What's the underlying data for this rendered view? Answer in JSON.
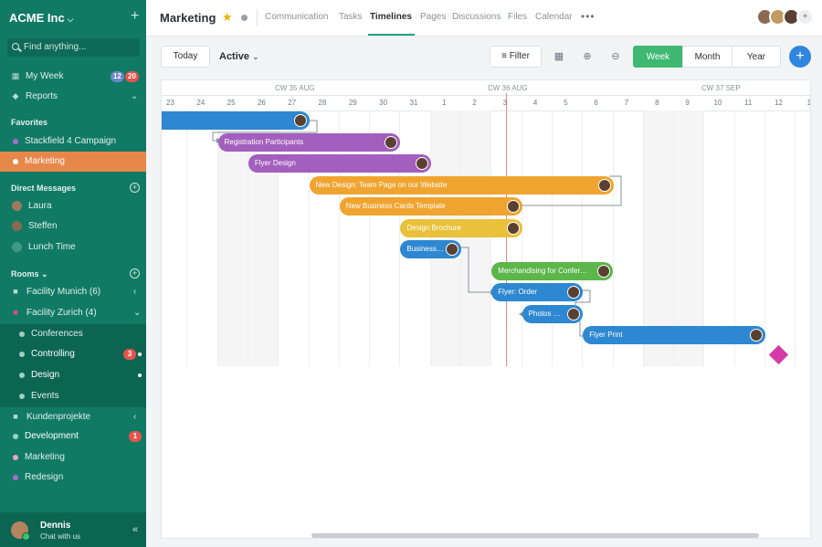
{
  "sidebar": {
    "workspace": "ACME Inc",
    "search_placeholder": "Find anything...",
    "my_week": "My Week",
    "my_week_badges": [
      "12",
      "20"
    ],
    "reports": "Reports",
    "favorites_heading": "Favorites",
    "favorites": [
      {
        "label": "Stackfield 4 Campaign",
        "color": "#a96bd0"
      },
      {
        "label": "Marketing",
        "color": "#ffffff"
      }
    ],
    "dm_heading": "Direct Messages",
    "dms": [
      "Laura",
      "Steffen",
      "Lunch Time"
    ],
    "rooms_heading": "Rooms",
    "rooms": {
      "facility_munich": "Facility Munich (6)",
      "facility_zurich": "Facility Zurich (4)",
      "zurich_children": [
        {
          "label": "Conferences",
          "badge": ""
        },
        {
          "label": "Controlling",
          "badge": "3"
        },
        {
          "label": "Design",
          "badge": ""
        },
        {
          "label": "Events",
          "badge": ""
        }
      ],
      "kundenprojekte": "Kundenprojekte",
      "development": "Development",
      "development_badge": "1",
      "marketing": "Marketing",
      "redesign": "Redesign"
    },
    "user": {
      "name": "Dennis",
      "status": "Chat with us"
    }
  },
  "topbar": {
    "title": "Marketing",
    "tabs": [
      "Communication",
      "Tasks",
      "Timelines",
      "Pages",
      "Discussions",
      "Files",
      "Calendar"
    ],
    "active_tab": "Timelines",
    "more": "•••",
    "add_member": "+"
  },
  "toolbar": {
    "today": "Today",
    "filter_value": "Active",
    "filter": "Filter",
    "views": [
      "Week",
      "Month",
      "Year"
    ],
    "active_view": "Week",
    "add": "+"
  },
  "timeline": {
    "weeks": [
      "CW 35 AUG",
      "CW 36 AUG",
      "CW 37 SEP"
    ],
    "days": [
      "23",
      "24",
      "25",
      "26",
      "27",
      "28",
      "29",
      "30",
      "31",
      "1",
      "2",
      "3",
      "4",
      "5",
      "6",
      "7",
      "8",
      "9",
      "10",
      "11",
      "12",
      "1"
    ],
    "today": "3",
    "tasks": [
      {
        "label": "",
        "color": "#2d87d1",
        "start": "23",
        "end": "27"
      },
      {
        "label": "Registration Participants",
        "color": "#a35fbd",
        "start": "25",
        "end": "30"
      },
      {
        "label": "Flyer Design",
        "color": "#a35fbd",
        "start": "26",
        "end": "31"
      },
      {
        "label": "New Design: Team Page on our Website",
        "color": "#f0a430",
        "start": "28",
        "end": "6"
      },
      {
        "label": "New Business Cards Template",
        "color": "#f0a430",
        "start": "29",
        "end": "3"
      },
      {
        "label": "Design Brochure",
        "color": "#e9c13a",
        "start": "31",
        "end": "3"
      },
      {
        "label": "Business…",
        "color": "#2d87d1",
        "start": "31",
        "end": "1"
      },
      {
        "label": "Merchandising for Confer…",
        "color": "#5cb64a",
        "start": "3",
        "end": "6"
      },
      {
        "label": "Flyer: Order",
        "color": "#2d87d1",
        "start": "3",
        "end": "5"
      },
      {
        "label": "Photos …",
        "color": "#2d87d1",
        "start": "4",
        "end": "5"
      },
      {
        "label": "Flyer Print",
        "color": "#2d87d1",
        "start": "6",
        "end": "11"
      }
    ],
    "milestone_color": "#d63aa6"
  }
}
